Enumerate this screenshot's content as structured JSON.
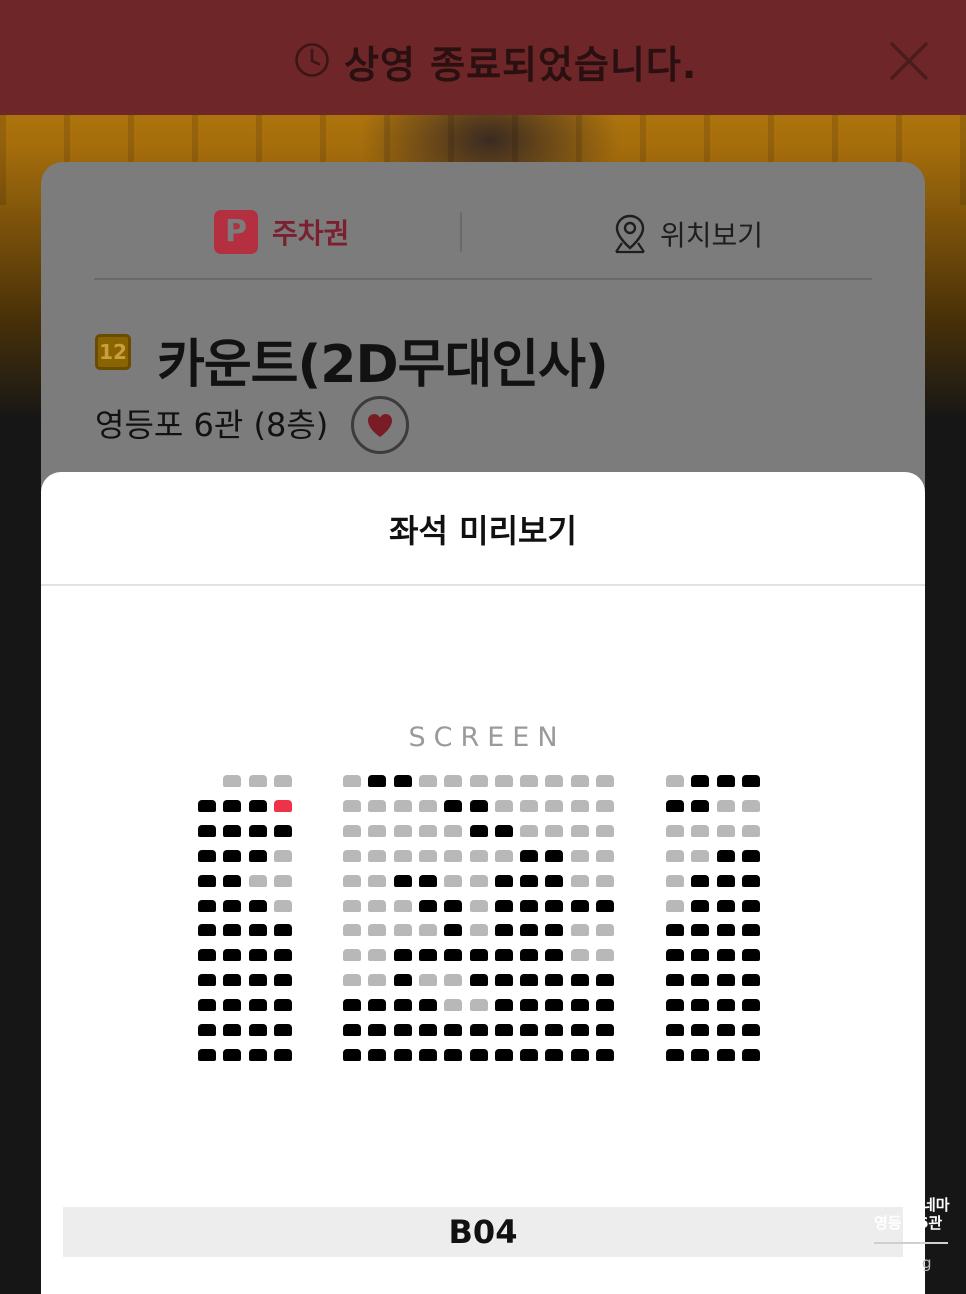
{
  "banner": {
    "message": "상영 종료되었습니다."
  },
  "info": {
    "parking_badge": "P",
    "parking_label": "주차권",
    "map_label": "위치보기",
    "rating": "12",
    "movie_title": "카운트(2D무대인사)",
    "venue": "영등포 6관  (8층)"
  },
  "sheet": {
    "title": "좌석 미리보기",
    "screen_label": "SCREEN",
    "selected_seat": "B04"
  },
  "watermark": {
    "line1": "네마",
    "line2": "영등",
    "line3": "6관",
    "line4": "g"
  },
  "seat_map": {
    "colors": {
      "sold": "#000000",
      "available": "#b8b8b8",
      "selected": "#ee3348"
    },
    "legend": "A=available, S=sold, X=selected, -=no seat",
    "sections": [
      {
        "name": "left",
        "rows": [
          "-AAA",
          "SSSX",
          "SSSS",
          "SSSA",
          "SSAA",
          "SSSA",
          "SSSS",
          "SSSS",
          "SSSS",
          "SSSS",
          "SSSS",
          "SSSS"
        ]
      },
      {
        "name": "center",
        "rows": [
          "ASSAAAAAAAA",
          "AAAASSAAAAA",
          "AAAAASSAAAA",
          "AAAAAAASSAA",
          "AASSAASSSAA",
          "AAASSASSSSS",
          "AAAASASSSAA",
          "AASSSSSSSAA",
          "AASAASSSSSS",
          "SSSSAASSSSS",
          "SSSSSSSSSSS",
          "SSSSSSSSSSS"
        ]
      },
      {
        "name": "right",
        "rows": [
          "ASSS",
          "SSAA",
          "AAAA",
          "AASS",
          "ASSS",
          "ASSS",
          "SSSS",
          "SSSS",
          "SSSS",
          "SSSS",
          "SSSS",
          "SSSS"
        ]
      }
    ]
  }
}
